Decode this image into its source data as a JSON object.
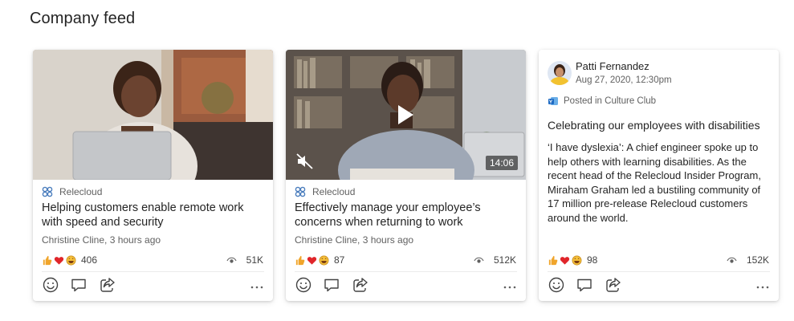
{
  "page": {
    "title": "Company feed"
  },
  "cards": [
    {
      "source": "Relecloud",
      "headline": "Helping customers enable remote work with speed and security",
      "byline": "Christine Cline, 3 hours ago",
      "reaction_count": "406",
      "views": "51K"
    },
    {
      "source": "Relecloud",
      "headline": "Effectively manage your employee’s concerns when returning to work",
      "byline": "Christine Cline, 3 hours ago",
      "reaction_count": "87",
      "views": "512K",
      "video_duration": "14:06"
    },
    {
      "author": "Patti Fernandez",
      "date": "Aug 27, 2020, 12:30pm",
      "posted_in": "Posted in Culture Club",
      "title": "Celebrating our employees with disabilities",
      "body": "‘I have dyslexia’: A chief engineer spoke up to help others with learning disabilities. As the recent head of the Relecloud Insider Program, Miraham Graham led a bustiling community of 17 million pre-release Relecloud customers around the world.",
      "reaction_count": "98",
      "views": "152K"
    }
  ],
  "icons": {
    "reactions": [
      "like-emoji",
      "heart-emoji",
      "laugh-emoji"
    ],
    "views": "eye-icon",
    "actions": [
      "add-reaction-icon",
      "comment-icon",
      "share-icon",
      "more-icon"
    ]
  },
  "colors": {
    "like": "#f0a52b",
    "heart": "#e0252a",
    "text_primary": "#242424",
    "text_secondary": "#616161",
    "source_logo": "#4a7dbd"
  }
}
